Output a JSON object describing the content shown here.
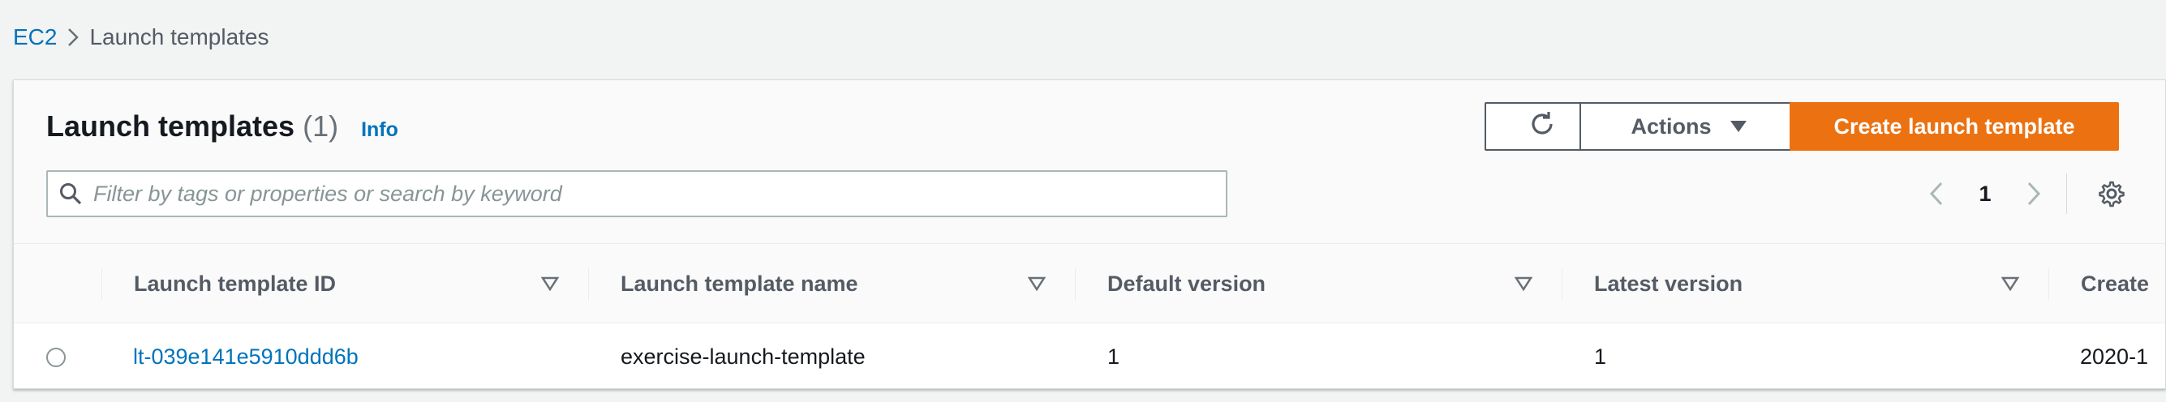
{
  "breadcrumb": {
    "root": "EC2",
    "current": "Launch templates"
  },
  "panel": {
    "title": "Launch templates",
    "count": "(1)",
    "info_label": "Info"
  },
  "toolbar": {
    "actions_label": "Actions",
    "create_label": "Create launch template"
  },
  "search": {
    "placeholder": "Filter by tags or properties or search by keyword",
    "value": ""
  },
  "pagination": {
    "current_page": "1"
  },
  "table": {
    "columns": [
      "Launch template ID",
      "Launch template name",
      "Default version",
      "Latest version",
      "Create"
    ],
    "rows": [
      {
        "id": "lt-039e141e5910ddd6b",
        "name": "exercise-launch-template",
        "default_version": "1",
        "latest_version": "1",
        "create_time": "2020-1"
      }
    ]
  },
  "colors": {
    "link": "#0073bb",
    "primary": "#ec7211",
    "text": "#16191f",
    "muted": "#545b64"
  }
}
